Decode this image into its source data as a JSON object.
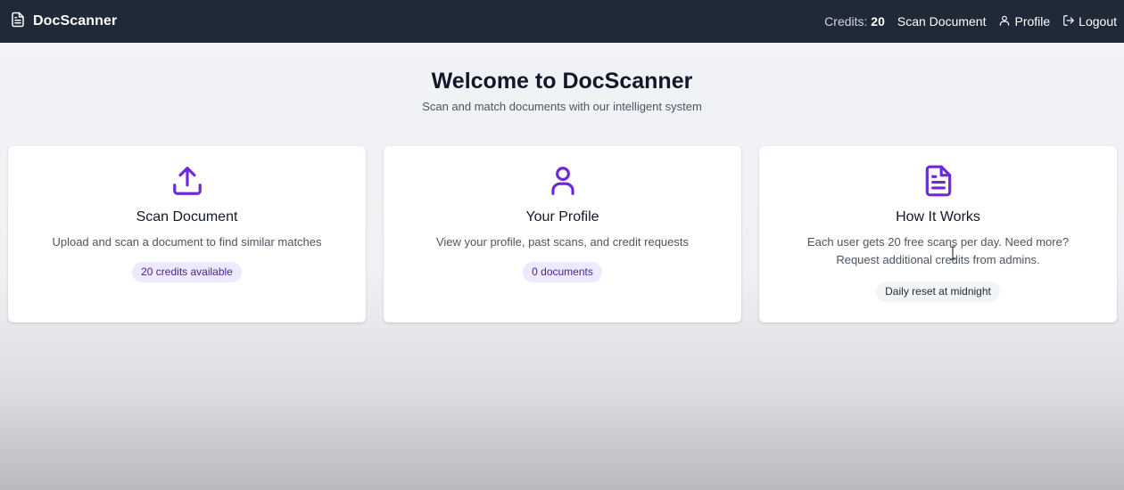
{
  "nav": {
    "brand": "DocScanner",
    "credits_label": "Credits:",
    "credits_value": "20",
    "links": [
      {
        "label": "Scan Document",
        "icon": "none"
      },
      {
        "label": "Profile",
        "icon": "user-icon"
      },
      {
        "label": "Logout",
        "icon": "logout-icon"
      }
    ]
  },
  "hero": {
    "title": "Welcome to DocScanner",
    "subtitle": "Scan and match documents with our intelligent system"
  },
  "cards": [
    {
      "icon": "upload-icon",
      "title": "Scan Document",
      "description": "Upload and scan a document to find similar matches",
      "badge": "20 credits available"
    },
    {
      "icon": "user-icon",
      "title": "Your Profile",
      "description": "View your profile, past scans, and credit requests",
      "badge": "0 documents"
    },
    {
      "icon": "document-icon",
      "title": "How It Works",
      "description": "Each user gets 20 free scans per day. Need more? Request additional credits from admins.",
      "badge": "Daily reset at midnight"
    }
  ],
  "colors": {
    "navbar": "#1f2937",
    "accent": "#6d28d9",
    "badge_purple_bg": "#ede9fe",
    "badge_gray_bg": "#f3f4f6"
  }
}
